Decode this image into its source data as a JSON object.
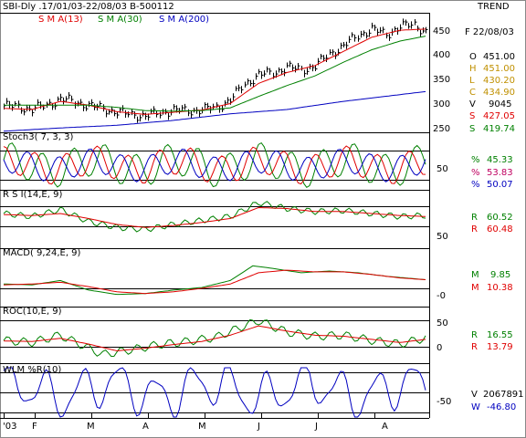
{
  "header": {
    "title": "SBI-Dly .17/01/03-22/08/03  B-500112",
    "sma13_label": "S M A(13)",
    "sma30_label": "S M A(30)",
    "sma200_label": "S M A(200)",
    "trend_label": "TREND"
  },
  "colors": {
    "price": "#000000",
    "sma13": "#e00000",
    "sma30": "#008000",
    "sma200": "#0000c0",
    "grid": "#000000",
    "background": "#ffffff"
  },
  "price_panel": {
    "y_ticks": [
      "450",
      "400",
      "350",
      "300",
      "250"
    ],
    "date_label": "F 22/08/03",
    "values": [
      {
        "key": "O",
        "value": "451.00",
        "color": "#000000"
      },
      {
        "key": "H",
        "value": "451.00",
        "color": "#c09000"
      },
      {
        "key": "L",
        "value": "430.20",
        "color": "#c09000"
      },
      {
        "key": "C",
        "value": "434.90",
        "color": "#c09000"
      },
      {
        "key": "V",
        "value": "9045",
        "color": "#000000"
      },
      {
        "key": "S",
        "value": "427.05",
        "color": "#e00000"
      },
      {
        "key": "S",
        "value": "419.74",
        "color": "#008000"
      }
    ]
  },
  "stoch_panel": {
    "label": "Stoch3( 7, 3, 3)",
    "y_tick": "50",
    "values": [
      {
        "key": "%",
        "value": "45.33",
        "color": "#008000"
      },
      {
        "key": "%",
        "value": "53.83",
        "color": "#e00000"
      },
      {
        "key": "%",
        "value": "50.07",
        "color": "#0000c0"
      }
    ]
  },
  "rsi_panel": {
    "label": "R S I(14,E, 9)",
    "y_tick": "50",
    "values": [
      {
        "key": "R",
        "value": "60.52",
        "color": "#008000"
      },
      {
        "key": "R",
        "value": "60.48",
        "color": "#e00000"
      }
    ]
  },
  "macd_panel": {
    "label": "MACD( 9,24,E, 9)",
    "y_tick": "-0",
    "values": [
      {
        "key": "M",
        "value": "9.85",
        "color": "#008000"
      },
      {
        "key": "M",
        "value": "10.38",
        "color": "#e00000"
      }
    ]
  },
  "roc_panel": {
    "label": "ROC(10,E, 9)",
    "y_ticks": [
      "50",
      "0"
    ],
    "values": [
      {
        "key": "R",
        "value": "16.55",
        "color": "#008000"
      },
      {
        "key": "R",
        "value": "13.79",
        "color": "#e00000"
      }
    ]
  },
  "wlm_panel": {
    "label": "WLM %R(10)",
    "y_tick": "-50",
    "values": [
      {
        "key": "V",
        "value": "2067891",
        "color": "#000000"
      },
      {
        "key": "W",
        "value": "-46.80",
        "color": "#0000c0"
      }
    ]
  },
  "x_axis": {
    "labels": [
      "'03",
      "F",
      "M",
      "A",
      "M",
      "J",
      "J",
      "A"
    ],
    "label_index": [
      0,
      11,
      31,
      51,
      71,
      91,
      111,
      131
    ]
  },
  "chart_data": {
    "type": "line",
    "title": "SBI-Dly .17/01/03-22/08/03  B-500112",
    "x_count": 150,
    "price": {
      "ylim": [
        250,
        460
      ],
      "series": [
        {
          "name": "S M A(13)",
          "anchors": [
            [
              0,
              294
            ],
            [
              10,
              292
            ],
            [
              20,
              307
            ],
            [
              30,
              300
            ],
            [
              40,
              288
            ],
            [
              50,
              283
            ],
            [
              60,
              287
            ],
            [
              70,
              291
            ],
            [
              80,
              303
            ],
            [
              90,
              340
            ],
            [
              100,
              360
            ],
            [
              110,
              373
            ],
            [
              120,
              399
            ],
            [
              130,
              425
            ],
            [
              140,
              438
            ],
            [
              149,
              440
            ]
          ]
        },
        {
          "name": "S M A(30)",
          "anchors": [
            [
              0,
              300
            ],
            [
              10,
              300
            ],
            [
              20,
              300
            ],
            [
              30,
              300
            ],
            [
              40,
              296
            ],
            [
              50,
              290
            ],
            [
              60,
              289
            ],
            [
              70,
              290
            ],
            [
              80,
              295
            ],
            [
              90,
              316
            ],
            [
              100,
              336
            ],
            [
              110,
              354
            ],
            [
              120,
              379
            ],
            [
              130,
              402
            ],
            [
              140,
              418
            ],
            [
              149,
              427
            ]
          ]
        },
        {
          "name": "S M A(200)",
          "anchors": [
            [
              0,
              252
            ],
            [
              20,
              258
            ],
            [
              40,
              263
            ],
            [
              60,
              272
            ],
            [
              80,
              284
            ],
            [
              100,
              292
            ],
            [
              120,
              307
            ],
            [
              149,
              325
            ]
          ]
        }
      ],
      "close_anchors": [
        [
          0,
          299
        ],
        [
          5,
          297
        ],
        [
          10,
          292
        ],
        [
          15,
          300
        ],
        [
          20,
          311
        ],
        [
          24,
          308
        ],
        [
          30,
          299
        ],
        [
          35,
          294
        ],
        [
          40,
          287
        ],
        [
          45,
          283
        ],
        [
          50,
          280
        ],
        [
          55,
          286
        ],
        [
          60,
          291
        ],
        [
          65,
          289
        ],
        [
          70,
          292
        ],
        [
          75,
          295
        ],
        [
          80,
          310
        ],
        [
          85,
          338
        ],
        [
          90,
          356
        ],
        [
          95,
          359
        ],
        [
          100,
          370
        ],
        [
          105,
          365
        ],
        [
          110,
          372
        ],
        [
          115,
          394
        ],
        [
          120,
          409
        ],
        [
          125,
          428
        ],
        [
          130,
          440
        ],
        [
          135,
          430
        ],
        [
          140,
          445
        ],
        [
          145,
          448
        ],
        [
          149,
          435
        ]
      ]
    },
    "stoch": {
      "ylim": [
        0,
        100
      ],
      "lines": [
        20,
        80
      ],
      "series": [
        {
          "name": "%K",
          "period": 11,
          "amp": 35,
          "center": 50,
          "phase": 0
        },
        {
          "name": "%D",
          "period": 11,
          "amp": 30,
          "center": 50,
          "phase": 1.5
        },
        {
          "name": "%slow",
          "period": 11,
          "amp": 26,
          "center": 50,
          "phase": 3
        }
      ]
    },
    "rsi": {
      "ylim": [
        30,
        85
      ],
      "lines": [
        50,
        70
      ],
      "series": [
        {
          "name": "R S I",
          "anchors": [
            [
              0,
              63
            ],
            [
              10,
              60
            ],
            [
              20,
              67
            ],
            [
              30,
              55
            ],
            [
              40,
              49
            ],
            [
              50,
              47
            ],
            [
              60,
              52
            ],
            [
              70,
              56
            ],
            [
              80,
              60
            ],
            [
              90,
              74
            ],
            [
              100,
              68
            ],
            [
              110,
              65
            ],
            [
              120,
              66
            ],
            [
              130,
              63
            ],
            [
              140,
              60
            ],
            [
              149,
              61
            ]
          ]
        },
        {
          "name": "Signal",
          "anchors": [
            [
              0,
              62
            ],
            [
              10,
              61
            ],
            [
              20,
              63
            ],
            [
              30,
              58
            ],
            [
              40,
              52
            ],
            [
              50,
              49
            ],
            [
              60,
              51
            ],
            [
              70,
              54
            ],
            [
              80,
              58
            ],
            [
              90,
              69
            ],
            [
              100,
              68
            ],
            [
              110,
              65
            ],
            [
              120,
              65
            ],
            [
              130,
              63
            ],
            [
              140,
              61
            ],
            [
              149,
              60
            ]
          ]
        }
      ]
    },
    "macd": {
      "ylim": [
        -20,
        40
      ],
      "lines": [
        0
      ],
      "series": [
        {
          "name": "MACD",
          "anchors": [
            [
              0,
              5
            ],
            [
              10,
              4
            ],
            [
              20,
              9
            ],
            [
              30,
              -2
            ],
            [
              40,
              -7
            ],
            [
              50,
              -6
            ],
            [
              60,
              -2
            ],
            [
              70,
              1
            ],
            [
              80,
              9
            ],
            [
              88,
              26
            ],
            [
              95,
              23
            ],
            [
              105,
              18
            ],
            [
              115,
              20
            ],
            [
              125,
              18
            ],
            [
              135,
              14
            ],
            [
              149,
              10
            ]
          ]
        },
        {
          "name": "Signal",
          "anchors": [
            [
              0,
              4
            ],
            [
              10,
              5
            ],
            [
              20,
              7
            ],
            [
              30,
              2
            ],
            [
              40,
              -4
            ],
            [
              50,
              -6
            ],
            [
              60,
              -4
            ],
            [
              70,
              0
            ],
            [
              80,
              5
            ],
            [
              90,
              18
            ],
            [
              100,
              21
            ],
            [
              110,
              19
            ],
            [
              120,
              19
            ],
            [
              130,
              16
            ],
            [
              140,
              12
            ],
            [
              149,
              10
            ]
          ]
        }
      ]
    },
    "roc": {
      "ylim": [
        -30,
        70
      ],
      "lines": [
        0,
        50
      ],
      "series": [
        {
          "name": "ROC",
          "anchors": [
            [
              0,
              12
            ],
            [
              10,
              8
            ],
            [
              20,
              22
            ],
            [
              28,
              2
            ],
            [
              35,
              -15
            ],
            [
              45,
              -6
            ],
            [
              55,
              4
            ],
            [
              65,
              10
            ],
            [
              75,
              18
            ],
            [
              85,
              40
            ],
            [
              90,
              50
            ],
            [
              100,
              28
            ],
            [
              110,
              20
            ],
            [
              120,
              22
            ],
            [
              130,
              12
            ],
            [
              140,
              5
            ],
            [
              149,
              17
            ]
          ]
        },
        {
          "name": "Signal",
          "anchors": [
            [
              0,
              11
            ],
            [
              10,
              10
            ],
            [
              20,
              16
            ],
            [
              30,
              5
            ],
            [
              40,
              -8
            ],
            [
              50,
              -3
            ],
            [
              60,
              4
            ],
            [
              70,
              10
            ],
            [
              80,
              22
            ],
            [
              90,
              40
            ],
            [
              100,
              30
            ],
            [
              110,
              22
            ],
            [
              120,
              20
            ],
            [
              130,
              14
            ],
            [
              140,
              8
            ],
            [
              149,
              14
            ]
          ]
        }
      ]
    },
    "wlm": {
      "ylim": [
        -100,
        0
      ],
      "lines": [
        -10,
        -50,
        -90
      ],
      "series": [
        {
          "name": "WLM %R",
          "period": 13,
          "amp": 40,
          "center": -45,
          "phase": 0.7
        }
      ]
    }
  }
}
